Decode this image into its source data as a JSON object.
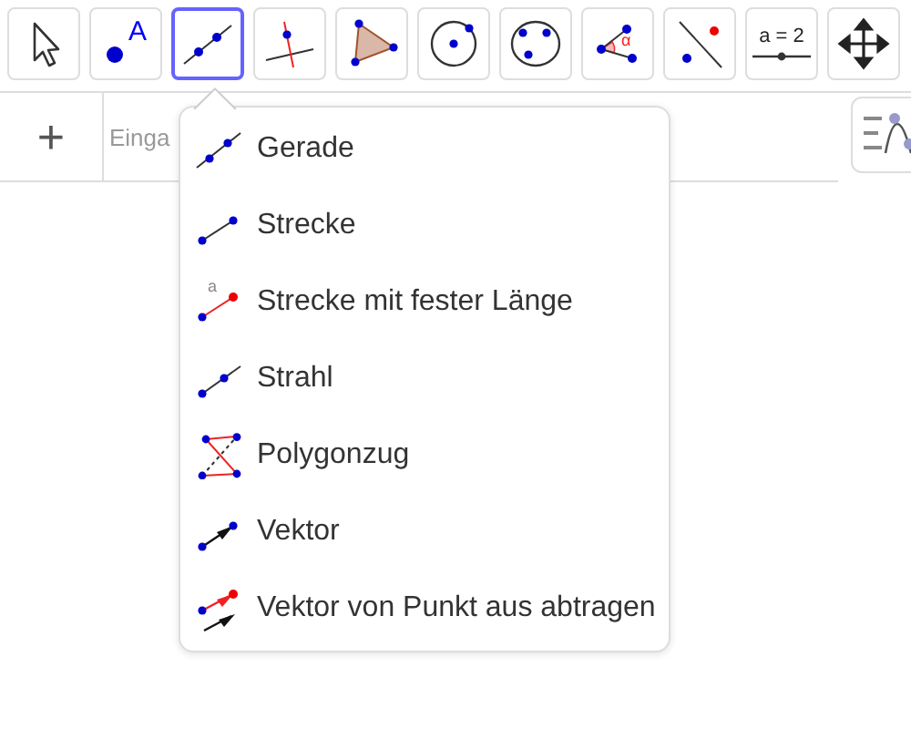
{
  "toolbar": {
    "tools": [
      {
        "kind": "move",
        "selected": false
      },
      {
        "kind": "point",
        "selected": false,
        "icon_label": "A"
      },
      {
        "kind": "line",
        "selected": true
      },
      {
        "kind": "perpendicular",
        "selected": false
      },
      {
        "kind": "polygon",
        "selected": false
      },
      {
        "kind": "circle-center",
        "selected": false
      },
      {
        "kind": "circle-three",
        "selected": false
      },
      {
        "kind": "angle",
        "selected": false,
        "icon_label": "α"
      },
      {
        "kind": "reflect",
        "selected": false
      },
      {
        "kind": "slider",
        "selected": false,
        "icon_label": "a = 2"
      },
      {
        "kind": "move-view",
        "selected": false
      }
    ]
  },
  "input_bar": {
    "add_symbol": "+",
    "placeholder": "Einga"
  },
  "tool_menu": {
    "items": [
      {
        "kind": "line",
        "label": "Gerade"
      },
      {
        "kind": "segment",
        "label": "Strecke"
      },
      {
        "kind": "segment-fixed",
        "label": "Strecke mit fester Länge",
        "icon_label": "a"
      },
      {
        "kind": "ray",
        "label": "Strahl"
      },
      {
        "kind": "polyline",
        "label": "Polygonzug"
      },
      {
        "kind": "vector",
        "label": "Vektor"
      },
      {
        "kind": "vector-from-point",
        "label": "Vektor von Punkt aus abtragen"
      }
    ]
  }
}
